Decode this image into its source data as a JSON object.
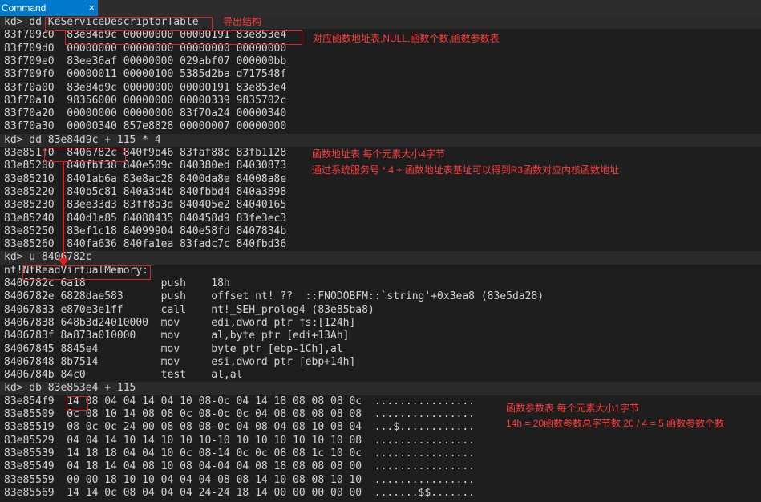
{
  "window": {
    "tab_title": "Command",
    "close_glyph": "×"
  },
  "lines": [
    {
      "text": "kd> dd KeServiceDescriptorTable",
      "kind": "prompt"
    },
    {
      "text": "83f709c0  83e84d9c 00000000 00000191 83e853e4",
      "kind": "out"
    },
    {
      "text": "83f709d0  00000000 00000000 00000000 00000000",
      "kind": "out"
    },
    {
      "text": "83f709e0  83ee36af 00000000 029abf07 000000bb",
      "kind": "out"
    },
    {
      "text": "83f709f0  00000011 00000100 5385d2ba d717548f",
      "kind": "out"
    },
    {
      "text": "83f70a00  83e84d9c 00000000 00000191 83e853e4",
      "kind": "out"
    },
    {
      "text": "83f70a10  98356000 00000000 00000339 9835702c",
      "kind": "out"
    },
    {
      "text": "83f70a20  00000000 00000000 83f70a24 00000340",
      "kind": "out"
    },
    {
      "text": "83f70a30  00000340 857e8828 00000007 00000000",
      "kind": "out"
    },
    {
      "text": "kd> dd 83e84d9c + 115 * 4",
      "kind": "prompt"
    },
    {
      "text": "83e851f0  8406782c 840f9b46 83faf88c 83fb1128",
      "kind": "out"
    },
    {
      "text": "83e85200  840fbf38 840e509c 840380ed 84030873",
      "kind": "out"
    },
    {
      "text": "83e85210  8401ab6a 83e8ac28 8400da8e 84008a8e",
      "kind": "out"
    },
    {
      "text": "83e85220  840b5c81 840a3d4b 840fbbd4 840a3898",
      "kind": "out"
    },
    {
      "text": "83e85230  83ee33d3 83ff8a3d 840405e2 84040165",
      "kind": "out"
    },
    {
      "text": "83e85240  840d1a85 84088435 840458d9 83fe3ec3",
      "kind": "out"
    },
    {
      "text": "83e85250  83ef1c18 84099904 840e58fd 8407834b",
      "kind": "out"
    },
    {
      "text": "83e85260  840fa636 840fa1ea 83fadc7c 840fbd36",
      "kind": "out"
    },
    {
      "text": "kd> u 8406782c",
      "kind": "prompt"
    },
    {
      "text": "nt!NtReadVirtualMemory:",
      "kind": "out"
    },
    {
      "text": "8406782c 6a18            push    18h",
      "kind": "out"
    },
    {
      "text": "8406782e 6828dae583      push    offset nt! ??  ::FNODOBFM::`string'+0x3ea8 (83e5da28)",
      "kind": "out"
    },
    {
      "text": "84067833 e870e3e1ff      call    nt!_SEH_prolog4 (83e85ba8)",
      "kind": "out"
    },
    {
      "text": "84067838 648b3d24010000  mov     edi,dword ptr fs:[124h]",
      "kind": "out"
    },
    {
      "text": "8406783f 8a873a010000    mov     al,byte ptr [edi+13Ah]",
      "kind": "out"
    },
    {
      "text": "84067845 8845e4          mov     byte ptr [ebp-1Ch],al",
      "kind": "out"
    },
    {
      "text": "84067848 8b7514          mov     esi,dword ptr [ebp+14h]",
      "kind": "out"
    },
    {
      "text": "8406784b 84c0            test    al,al",
      "kind": "out"
    },
    {
      "text": "kd> db 83e853e4 + 115",
      "kind": "prompt"
    },
    {
      "text": "83e854f9  14 08 04 04 14 04 10 08-0c 04 14 18 08 08 08 0c  ................",
      "kind": "out"
    },
    {
      "text": "83e85509  0c 08 10 14 08 08 0c 08-0c 0c 04 08 08 08 08 08  ................",
      "kind": "out"
    },
    {
      "text": "83e85519  08 0c 0c 24 00 08 08 08-0c 04 08 04 08 10 08 04  ...$............",
      "kind": "out"
    },
    {
      "text": "83e85529  04 04 14 10 14 10 10 10-10 10 10 10 10 10 10 08  ................",
      "kind": "out"
    },
    {
      "text": "83e85539  14 18 18 04 04 10 0c 08-14 0c 0c 08 08 1c 10 0c  ................",
      "kind": "out"
    },
    {
      "text": "83e85549  04 18 14 04 08 10 08 04-04 04 08 18 08 08 08 00  ................",
      "kind": "out"
    },
    {
      "text": "83e85559  00 00 18 10 10 04 04 04-08 08 14 10 08 08 10 10  ................",
      "kind": "out"
    },
    {
      "text": "83e85569  14 14 0c 08 04 04 04 24-24 18 14 00 00 00 00 00  .......$$.......",
      "kind": "out"
    }
  ],
  "annotations": {
    "export_structure": "导出结构",
    "table_desc": "对应函数地址表,NULL,函数个数,函数参数表",
    "func_table_desc": "函数地址表 每个元素大小4字节",
    "syscall_desc": "通过系统服务号 * 4 + 函数地址表基址可以得到R3函数对应内核函数地址",
    "param_table_desc": "函数参数表 每个元素大小1字节",
    "param_count_desc": "14h = 20函数参数总字节数 20 / 4 = 5 函数参数个数"
  },
  "colors": {
    "background": "#1e1e1e",
    "prompt_band": "#2a2a2a",
    "tab": "#007acc",
    "annotation": "#ff3c3c",
    "text": "#d4d4d4"
  }
}
